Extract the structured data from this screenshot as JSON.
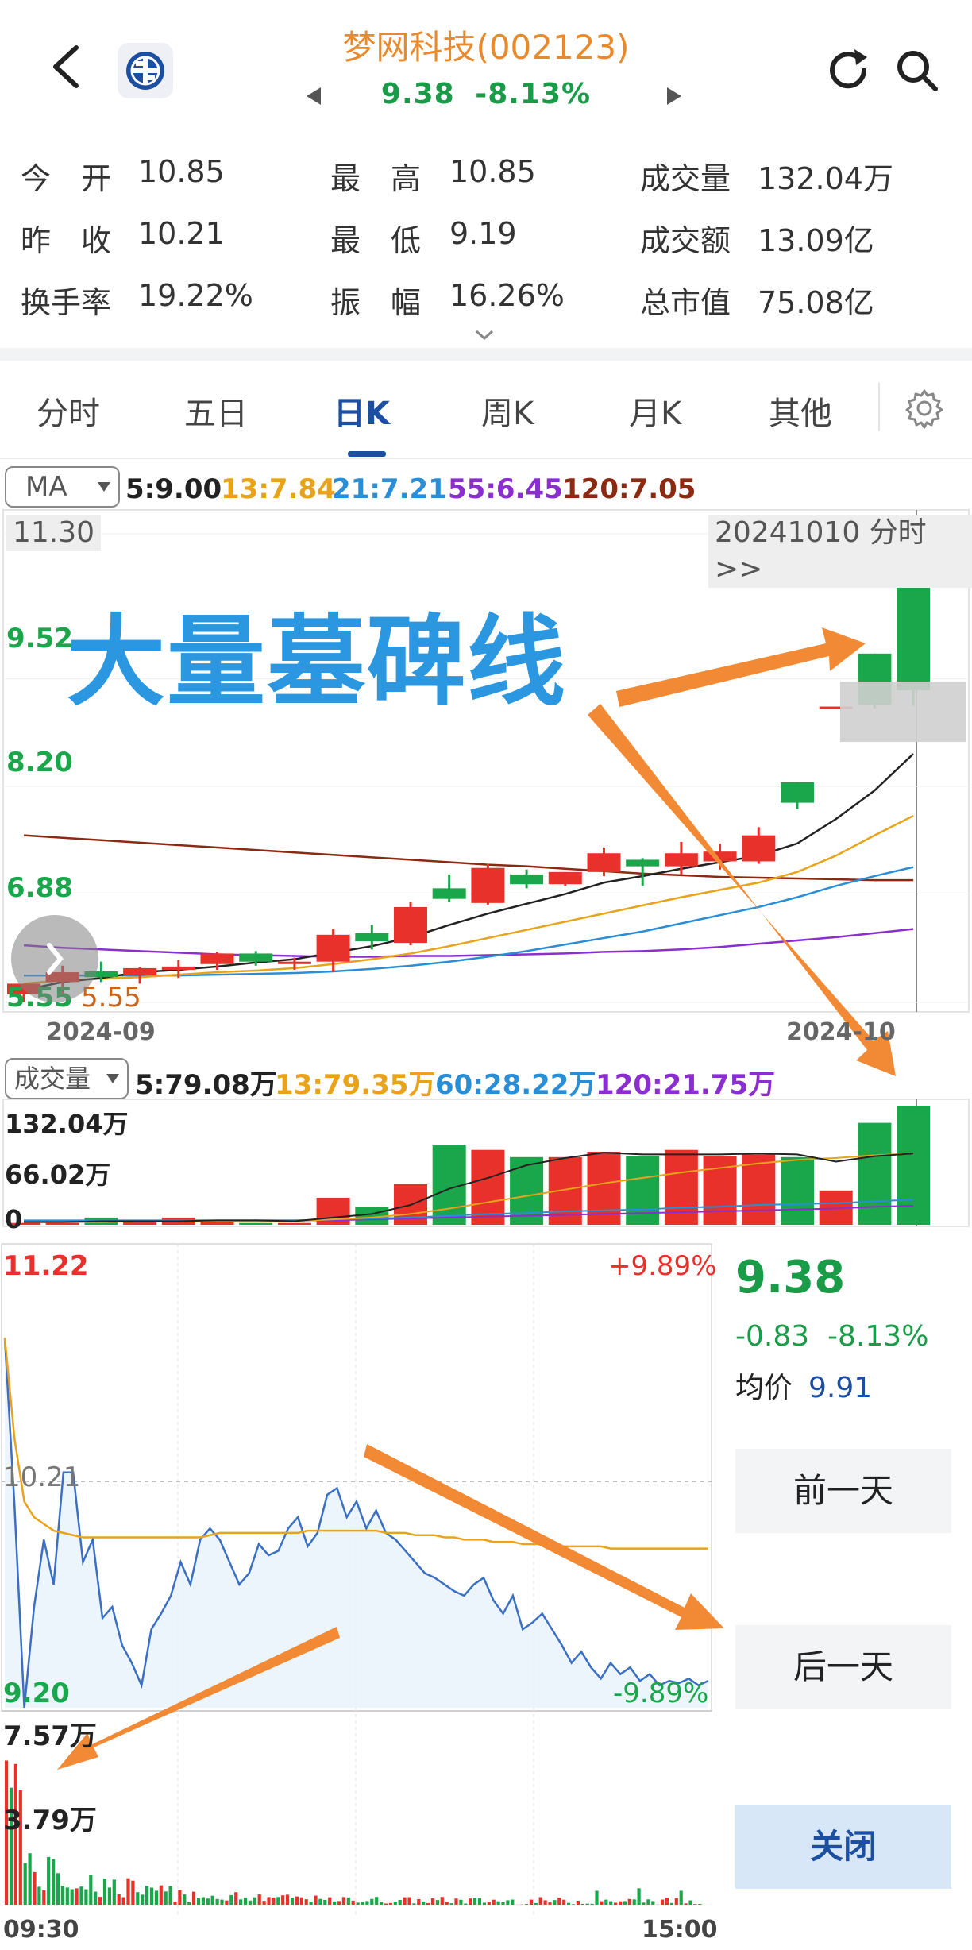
{
  "header": {
    "title": "梦网科技(002123)",
    "price": "9.38",
    "change_pct": "-8.13%"
  },
  "quote": {
    "rows": [
      [
        {
          "label": "今　开",
          "value": "10.85"
        },
        {
          "label": "最　高",
          "value": "10.85"
        },
        {
          "label": "成交量",
          "value": "132.04万"
        }
      ],
      [
        {
          "label": "昨　收",
          "value": "10.21"
        },
        {
          "label": "最　低",
          "value": "9.19"
        },
        {
          "label": "成交额",
          "value": "13.09亿"
        }
      ],
      [
        {
          "label": "换手率",
          "value": "19.22%"
        },
        {
          "label": "振　幅",
          "value": "16.26%"
        },
        {
          "label": "总市值",
          "value": "75.08亿"
        }
      ]
    ]
  },
  "tabs": [
    "分时",
    "五日",
    "日K",
    "周K",
    "月K",
    "其他"
  ],
  "active_tab": "日K",
  "ma": {
    "selector": "MA",
    "items": [
      {
        "label": "5:9.00",
        "color": "#222222"
      },
      {
        "label": "13:7.84",
        "color": "#e8a31a"
      },
      {
        "label": "21:7.21",
        "color": "#2a8ed6"
      },
      {
        "label": "55:6.45",
        "color": "#8a2ecf"
      },
      {
        "label": "120:7.05",
        "color": "#8b2a10"
      }
    ]
  },
  "kline": {
    "y_labels": [
      "11.30",
      "9.52",
      "8.20",
      "6.88",
      "5.55"
    ],
    "low_marker": "5.55",
    "date_box": "20241010 分时>>",
    "x_labels": [
      "2024-09",
      "2024-10"
    ],
    "banner": "大量墓碑线",
    "colors": {
      "up": "#e8312a",
      "down": "#1aa64a"
    }
  },
  "volume": {
    "selector": "成交量",
    "items": [
      {
        "label": "5:79.08万",
        "color": "#222222"
      },
      {
        "label": "13:79.35万",
        "color": "#e8a31a"
      },
      {
        "label": "60:28.22万",
        "color": "#2a8ed6"
      },
      {
        "label": "120:21.75万",
        "color": "#8a2ecf"
      }
    ],
    "y_labels": [
      "132.04万",
      "66.02万",
      "0"
    ]
  },
  "timeshare": {
    "high": "11.22",
    "low": "9.20",
    "prev_close": "10.21",
    "up_pct": "+9.89%",
    "down_pct": "-9.89%",
    "vol_labels": [
      "7.57万",
      "3.79万"
    ],
    "times": [
      "09:30",
      "15:00"
    ]
  },
  "side_panel": {
    "price": "9.38",
    "change": "-0.83",
    "change_pct": "-8.13%",
    "avg_label": "均价",
    "avg_value": "9.91",
    "prev_day": "前一天",
    "next_day": "后一天",
    "close": "关闭"
  },
  "chart_data": {
    "type": "candlestick",
    "x_labels": [
      "2024-09",
      "2024-10"
    ],
    "y_ticks": [
      11.3,
      9.52,
      8.2,
      6.88,
      5.55
    ],
    "candles": [
      {
        "o": 5.65,
        "h": 5.78,
        "l": 5.55,
        "c": 5.78
      },
      {
        "o": 5.8,
        "h": 6.0,
        "l": 5.62,
        "c": 5.92
      },
      {
        "o": 5.93,
        "h": 6.05,
        "l": 5.8,
        "c": 5.86
      },
      {
        "o": 5.88,
        "h": 5.98,
        "l": 5.78,
        "c": 5.97
      },
      {
        "o": 5.95,
        "h": 6.07,
        "l": 5.85,
        "c": 5.99
      },
      {
        "o": 6.02,
        "h": 6.17,
        "l": 5.95,
        "c": 6.15
      },
      {
        "o": 6.15,
        "h": 6.18,
        "l": 6.0,
        "c": 6.05
      },
      {
        "o": 6.02,
        "h": 6.1,
        "l": 5.95,
        "c": 6.05
      },
      {
        "o": 6.05,
        "h": 6.45,
        "l": 5.92,
        "c": 6.38
      },
      {
        "o": 6.4,
        "h": 6.5,
        "l": 6.2,
        "c": 6.3
      },
      {
        "o": 6.28,
        "h": 6.78,
        "l": 6.25,
        "c": 6.72
      },
      {
        "o": 6.95,
        "h": 7.12,
        "l": 6.78,
        "c": 6.82
      },
      {
        "o": 6.77,
        "h": 7.25,
        "l": 6.75,
        "c": 7.2
      },
      {
        "o": 7.12,
        "h": 7.18,
        "l": 6.95,
        "c": 7.0
      },
      {
        "o": 7.0,
        "h": 7.15,
        "l": 6.98,
        "c": 7.15
      },
      {
        "o": 7.15,
        "h": 7.45,
        "l": 7.1,
        "c": 7.38
      },
      {
        "o": 7.3,
        "h": 7.32,
        "l": 6.98,
        "c": 7.22
      },
      {
        "o": 7.22,
        "h": 7.52,
        "l": 7.12,
        "c": 7.38
      },
      {
        "o": 7.28,
        "h": 7.5,
        "l": 7.18,
        "c": 7.4
      },
      {
        "o": 7.28,
        "h": 7.7,
        "l": 7.25,
        "c": 7.6
      },
      {
        "o": 8.25,
        "h": 8.25,
        "l": 7.92,
        "c": 8.0
      },
      {
        "o": 9.18,
        "h": 9.18,
        "l": 9.18,
        "c": 9.18
      },
      {
        "o": 9.83,
        "h": 9.83,
        "l": 9.16,
        "c": 9.2
      },
      {
        "o": 10.85,
        "h": 10.85,
        "l": 9.19,
        "c": 9.38
      }
    ],
    "ma5": [
      5.7,
      5.8,
      5.85,
      5.92,
      5.95,
      5.99,
      6.04,
      6.08,
      6.16,
      6.24,
      6.35,
      6.5,
      6.64,
      6.76,
      6.88,
      7.02,
      7.1,
      7.19,
      7.27,
      7.35,
      7.5,
      7.8,
      8.15,
      8.6
    ],
    "ma13": [
      5.78,
      5.82,
      5.84,
      5.86,
      5.89,
      5.92,
      5.94,
      5.97,
      6.02,
      6.08,
      6.15,
      6.24,
      6.34,
      6.44,
      6.54,
      6.64,
      6.74,
      6.84,
      6.93,
      7.02,
      7.15,
      7.35,
      7.6,
      7.84
    ],
    "ma21": [
      5.88,
      5.88,
      5.88,
      5.88,
      5.88,
      5.89,
      5.9,
      5.91,
      5.93,
      5.96,
      6.0,
      6.05,
      6.11,
      6.18,
      6.26,
      6.34,
      6.42,
      6.52,
      6.62,
      6.72,
      6.84,
      6.98,
      7.1,
      7.21
    ],
    "ma55": [
      6.25,
      6.22,
      6.2,
      6.18,
      6.16,
      6.14,
      6.13,
      6.12,
      6.11,
      6.11,
      6.12,
      6.12,
      6.13,
      6.14,
      6.15,
      6.17,
      6.18,
      6.2,
      6.23,
      6.27,
      6.31,
      6.35,
      6.4,
      6.45
    ],
    "ma120": [
      7.6,
      7.57,
      7.54,
      7.51,
      7.48,
      7.45,
      7.42,
      7.39,
      7.36,
      7.33,
      7.3,
      7.27,
      7.24,
      7.22,
      7.19,
      7.16,
      7.13,
      7.11,
      7.09,
      7.08,
      7.07,
      7.06,
      7.05,
      7.05
    ],
    "volume": [
      2,
      2,
      8,
      3,
      8,
      3,
      2,
      2,
      30,
      20,
      45,
      88,
      83,
      75,
      75,
      81,
      76,
      83,
      76,
      78,
      75,
      38,
      113,
      132
    ],
    "vol_ma5": [
      3,
      3,
      4,
      4,
      4,
      5,
      5,
      4,
      8,
      12,
      22,
      40,
      52,
      66,
      74,
      80,
      78,
      78,
      78,
      79,
      78,
      70,
      76,
      79
    ],
    "vol_ma13": [
      3,
      3,
      3,
      4,
      4,
      4,
      4,
      4,
      6,
      8,
      12,
      18,
      25,
      32,
      39,
      46,
      52,
      58,
      63,
      68,
      72,
      74,
      77,
      79
    ],
    "vol_ma60": [
      5,
      5,
      5,
      5,
      5,
      5,
      5,
      5,
      6,
      7,
      8,
      10,
      12,
      13,
      15,
      16,
      17,
      19,
      20,
      22,
      23,
      24,
      26,
      28
    ],
    "vol_ma120": [
      4,
      4,
      4,
      4,
      4,
      4,
      5,
      5,
      5,
      6,
      7,
      8,
      9,
      10,
      11,
      12,
      13,
      14,
      15,
      16,
      17,
      18,
      20,
      21
    ],
    "intraday_price": [
      10.85,
      10.1,
      9.2,
      9.65,
      9.95,
      9.75,
      10.25,
      10.25,
      9.85,
      9.95,
      9.6,
      9.65,
      9.48,
      9.4,
      9.3,
      9.55,
      9.62,
      9.7,
      9.85,
      9.75,
      9.95,
      10.0,
      9.95,
      9.85,
      9.75,
      9.8,
      9.93,
      9.88,
      9.9,
      10.0,
      10.05,
      9.92,
      9.98,
      10.15,
      10.18,
      10.05,
      10.12,
      10.0,
      10.08,
      9.98,
      9.95,
      9.9,
      9.85,
      9.8,
      9.78,
      9.75,
      9.72,
      9.7,
      9.75,
      9.78,
      9.68,
      9.62,
      9.7,
      9.55,
      9.58,
      9.62,
      9.55,
      9.48,
      9.4,
      9.45,
      9.38,
      9.33,
      9.4,
      9.35,
      9.38,
      9.32,
      9.35,
      9.3,
      9.32,
      9.31,
      9.33,
      9.3,
      9.32
    ],
    "intraday_avg": [
      10.85,
      10.4,
      10.12,
      10.05,
      10.02,
      9.99,
      9.98,
      9.97,
      9.96,
      9.96,
      9.96,
      9.96,
      9.96,
      9.96,
      9.96,
      9.96,
      9.96,
      9.96,
      9.96,
      9.96,
      9.96,
      9.97,
      9.98,
      9.98,
      9.98,
      9.98,
      9.98,
      9.98,
      9.98,
      9.98,
      9.98,
      9.99,
      9.99,
      9.99,
      9.99,
      9.99,
      9.99,
      9.99,
      9.99,
      9.98,
      9.98,
      9.98,
      9.97,
      9.97,
      9.97,
      9.96,
      9.96,
      9.95,
      9.95,
      9.95,
      9.94,
      9.94,
      9.94,
      9.93,
      9.93,
      9.93,
      9.93,
      9.92,
      9.92,
      9.92,
      9.92,
      9.92,
      9.91,
      9.91,
      9.91,
      9.91,
      9.91,
      9.91,
      9.91,
      9.91,
      9.91,
      9.91,
      9.91
    ],
    "intraday_volume_max": 7.57
  }
}
